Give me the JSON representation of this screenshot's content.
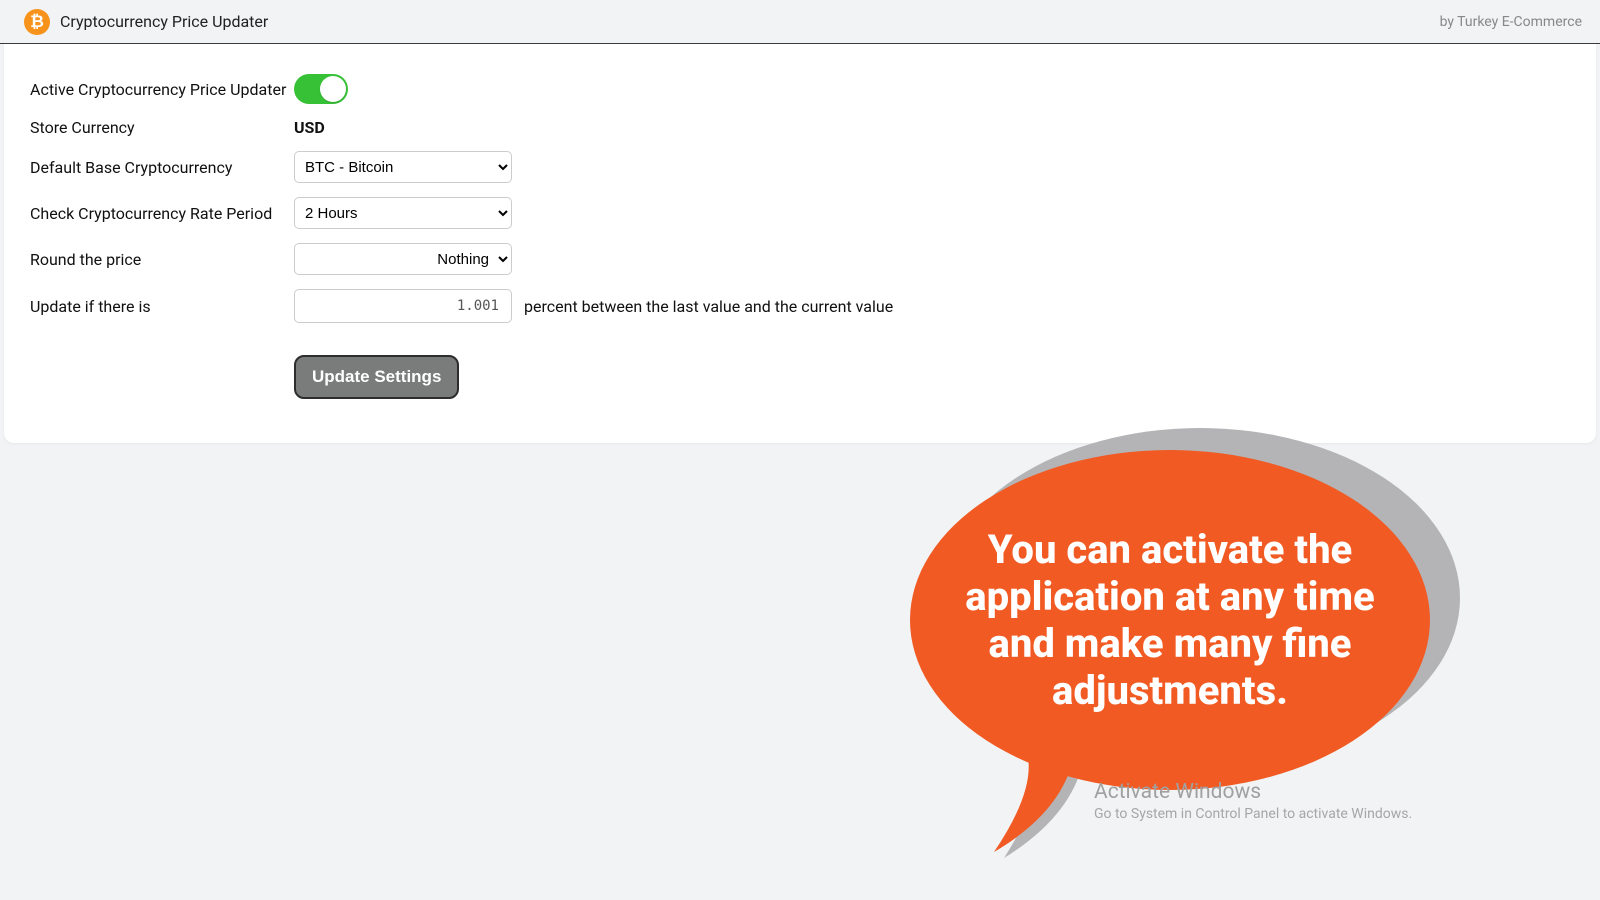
{
  "header": {
    "title": "Cryptocurrency Price Updater",
    "byline": "by Turkey E-Commerce"
  },
  "form": {
    "active_label": "Active Cryptocurrency Price Updater",
    "active_value": true,
    "store_currency_label": "Store Currency",
    "store_currency_value": "USD",
    "default_base_label": "Default Base Cryptocurrency",
    "default_base_value": "BTC - Bitcoin",
    "rate_period_label": "Check Cryptocurrency Rate Period",
    "rate_period_value": "2 Hours",
    "round_label": "Round the price",
    "round_value": "Nothing",
    "update_if_label": "Update if there is",
    "update_if_value": "1.001",
    "update_if_suffix": "percent between the last value and the current value",
    "update_button": "Update Settings"
  },
  "callout": {
    "text": "You can activate the application at any time and make many fine adjustments."
  },
  "watermark": {
    "title": "Activate Windows",
    "subtitle": "Go to System in Control Panel to activate Windows."
  },
  "colors": {
    "accent": "#f15a22",
    "toggle_on": "#37c137",
    "btc": "#f7931a"
  }
}
